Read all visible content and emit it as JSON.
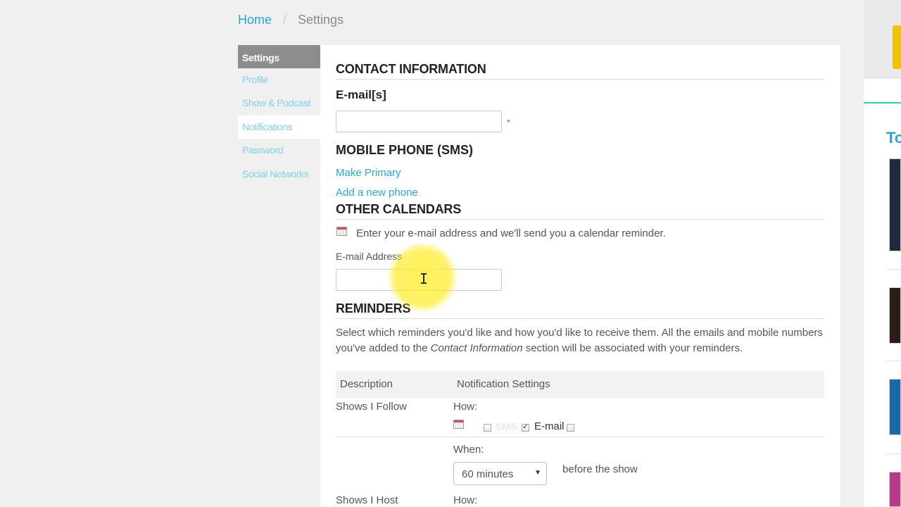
{
  "breadcrumb": {
    "home": "Home",
    "separator": "/",
    "current": "Settings"
  },
  "sidebar": {
    "active": "Settings",
    "items": [
      {
        "label": "Profile"
      },
      {
        "label": "Show & Podcast"
      },
      {
        "label": "Notifications"
      },
      {
        "label": "Password"
      },
      {
        "label": "Social Networks"
      }
    ]
  },
  "contact": {
    "title": "CONTACT INFORMATION",
    "emails_label": "E-mail[s]",
    "email_value": "",
    "required_mark": "*"
  },
  "mobile": {
    "title": "MOBILE PHONE (SMS)",
    "make_primary": "Make Primary",
    "add_phone": "Add a new phone"
  },
  "calendars": {
    "title": "OTHER CALENDARS",
    "description": "Enter your e-mail address and we'll send you a calendar reminder.",
    "email_label": "E-mail Address",
    "email_value": "",
    "icon": "calendar-icon"
  },
  "reminders": {
    "title": "REMINDERS",
    "description_1": "Select which reminders you'd like and how you'd like to receive them. All the emails and mobile numbers you've added to the ",
    "description_em": "Contact Information",
    "description_2": " section will be associated with your reminders.",
    "table": {
      "col_description": "Description",
      "col_settings": "Notification Settings",
      "rows": [
        {
          "description": "Shows I Follow",
          "how_label": "How:",
          "sms_label": "SMS",
          "email_label": "E-mail",
          "sms_checked": false,
          "email_checked": true,
          "when_label": "When:",
          "when_value": "60 minutes",
          "when_suffix": "before the show"
        },
        {
          "description": "Shows I Host",
          "how_label": "How:"
        }
      ]
    }
  },
  "right_panel": {
    "heading": "To"
  },
  "colors": {
    "accent": "#2aa6d6",
    "required": "#e23b3b",
    "sidebar_active": "#8d8d8d",
    "highlight": "#ffec3c"
  }
}
